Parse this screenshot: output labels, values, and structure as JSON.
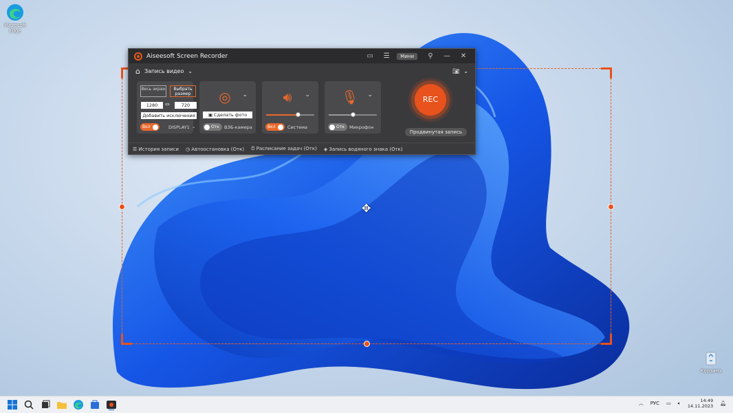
{
  "desktop": {
    "icons": [
      {
        "name": "edge",
        "label": "Microsoft Edge"
      },
      {
        "name": "recycle-bin",
        "label": "Корзина"
      }
    ]
  },
  "recorder": {
    "title": "Aiseesoft Screen Recorder",
    "mini_label": "Мини",
    "mode_label": "Запись видео",
    "display": {
      "full_screen_label": "Весь экран",
      "select_size_label": "Выбрать размер",
      "width": "1280",
      "height": "720",
      "add_exclusion_label": "Добавить исключения",
      "toggle_label": "Вкл",
      "display_name": "DISPLAY1"
    },
    "webcam": {
      "snapshot_label": "Сделать фото",
      "toggle_label": "Отк",
      "label": "ВЭБ-камера"
    },
    "system": {
      "toggle_label": "Вкл",
      "label": "Система",
      "volume": 0.65
    },
    "mic": {
      "toggle_label": "Отк",
      "label": "Микрофон",
      "volume": 0.5
    },
    "rec_label": "REC",
    "advanced_label": "Продвинутая запись",
    "footer": {
      "history": "История записи",
      "autostop": "Автоостановка (Отк)",
      "schedule": "Расписание задач (Отк)",
      "watermark": "Запись водяного знака (Отк)"
    }
  },
  "taskbar": {
    "lang": "РУС",
    "time": "14:49",
    "date": "14.11.2023"
  },
  "colors": {
    "accent": "#e8521c",
    "window_bg": "#3a3a3d"
  }
}
